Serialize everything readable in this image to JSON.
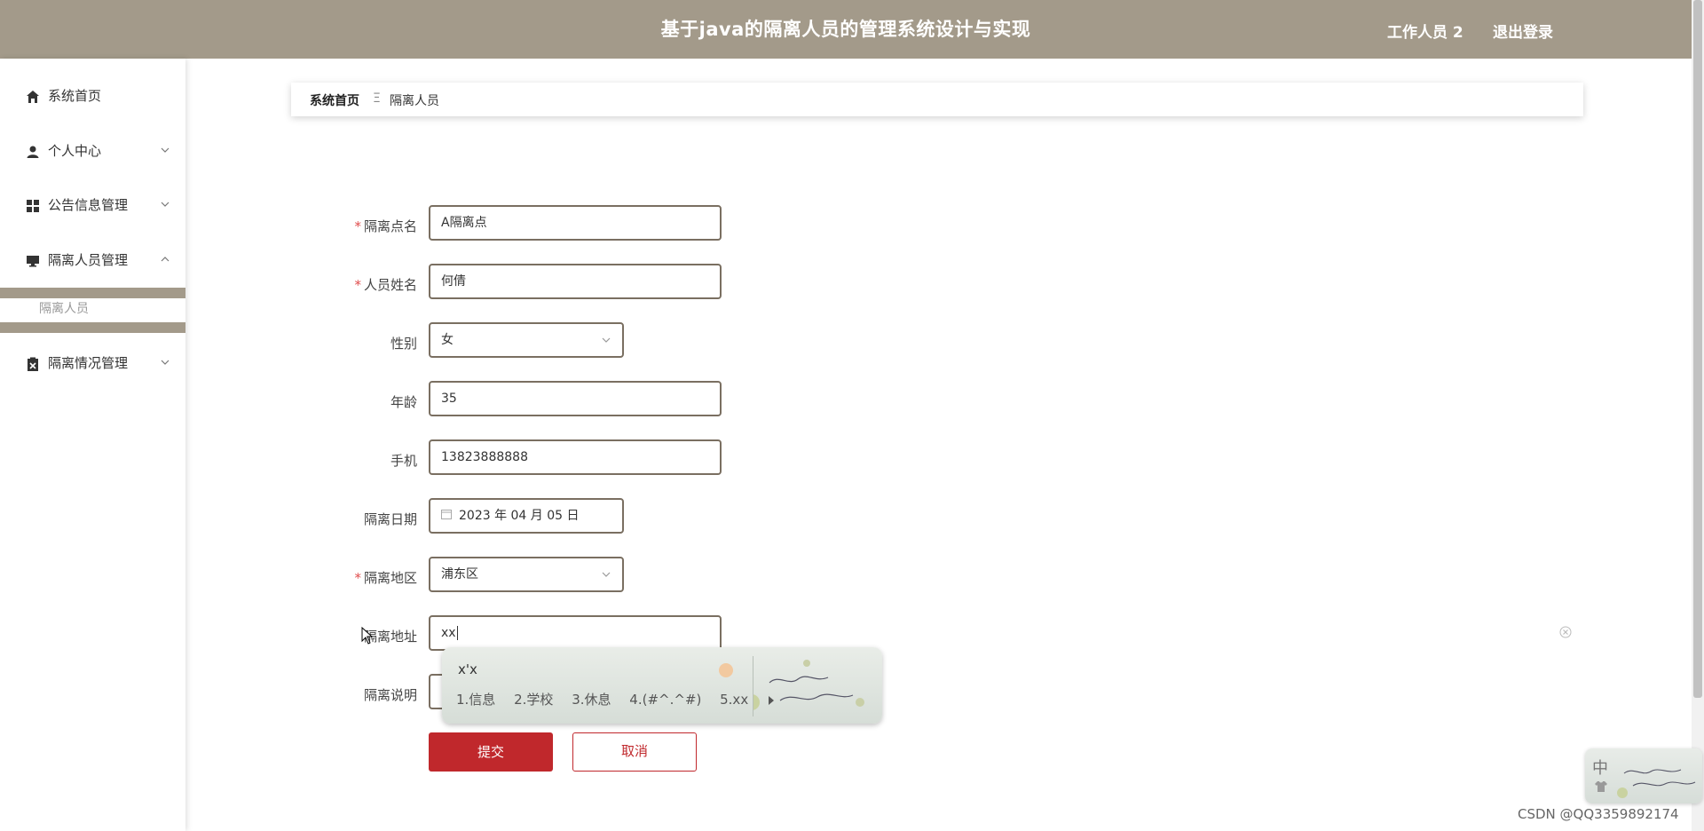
{
  "header": {
    "title": "基于java的隔离人员的管理系统设计与实现",
    "user": "工作人员 2",
    "logout": "退出登录",
    "background_color": "#a39a8a"
  },
  "sidebar": {
    "items": [
      {
        "label": "系统首页",
        "icon": "home-icon"
      },
      {
        "label": "个人中心",
        "icon": "user-icon",
        "chevron": "down"
      },
      {
        "label": "公告信息管理",
        "icon": "grid-icon",
        "chevron": "down"
      },
      {
        "label": "隔离人员管理",
        "icon": "monitor-icon",
        "chevron": "up",
        "expanded": true
      },
      {
        "label": "隔离情况管理",
        "icon": "clipboard-icon",
        "chevron": "down"
      }
    ],
    "submenu": {
      "label": "隔离人员",
      "active": true
    }
  },
  "breadcrumb": {
    "home": "系统首页",
    "separator": "Ξ",
    "current": "隔离人员"
  },
  "form": {
    "fields": [
      {
        "label": "隔离点名",
        "required": true,
        "value": "A隔离点",
        "type": "text"
      },
      {
        "label": "人员姓名",
        "required": true,
        "value": "何倩",
        "type": "text"
      },
      {
        "label": "性别",
        "required": false,
        "value": "女",
        "type": "select"
      },
      {
        "label": "年龄",
        "required": false,
        "value": "35",
        "type": "text"
      },
      {
        "label": "手机",
        "required": false,
        "value": "13823888888",
        "type": "text"
      },
      {
        "label": "隔离日期",
        "required": false,
        "value": "2023 年 04 月 05 日",
        "type": "date"
      },
      {
        "label": "隔离地区",
        "required": true,
        "value": "浦东区",
        "type": "select"
      },
      {
        "label": "隔离地址",
        "required": false,
        "value": "xx",
        "type": "text",
        "focused": true
      },
      {
        "label": "隔离说明",
        "required": false,
        "value": "",
        "type": "text"
      }
    ],
    "required_mark": "*",
    "submit": "提交",
    "cancel": "取消",
    "accent_color": "#c0282c"
  },
  "ime": {
    "composition": "x'x",
    "candidates": [
      "1.信息",
      "2.学校",
      "3.休息",
      "4.(#^.^#)",
      "5.xx"
    ],
    "mode": "中"
  },
  "watermark": "CSDN @QQ3359892174"
}
